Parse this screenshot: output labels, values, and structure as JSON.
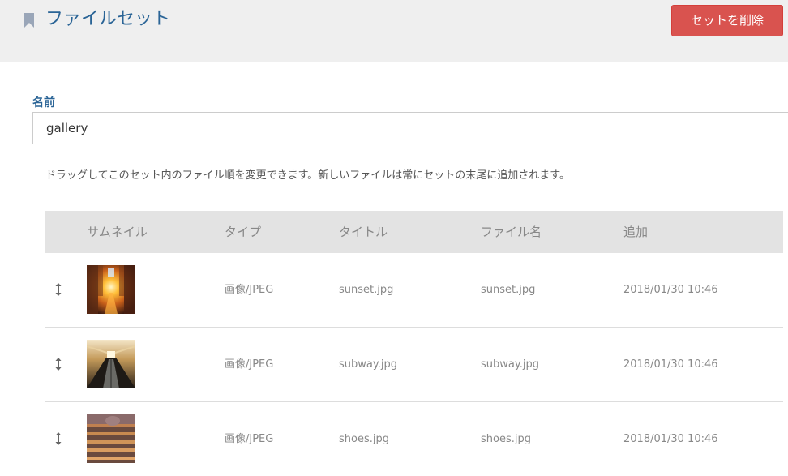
{
  "header": {
    "title": "ファイルセット",
    "delete_button": "セットを削除"
  },
  "form": {
    "name_label": "名前",
    "name_value": "gallery"
  },
  "help_text": "ドラッグしてこのセット内のファイル順を変更できます。新しいファイルは常にセットの末尾に追加されます。",
  "table": {
    "columns": [
      "サムネイル",
      "タイプ",
      "タイトル",
      "ファイル名",
      "追加"
    ],
    "rows": [
      {
        "type": "画像/JPEG",
        "title": "sunset.jpg",
        "filename": "sunset.jpg",
        "added": "2018/01/30 10:46",
        "thumb": "sunset"
      },
      {
        "type": "画像/JPEG",
        "title": "subway.jpg",
        "filename": "subway.jpg",
        "added": "2018/01/30 10:46",
        "thumb": "subway"
      },
      {
        "type": "画像/JPEG",
        "title": "shoes.jpg",
        "filename": "shoes.jpg",
        "added": "2018/01/30 10:46",
        "thumb": "shoes"
      }
    ]
  },
  "colors": {
    "title": "#2a6496",
    "danger": "#d9534f",
    "header_bg": "#efefef",
    "table_head_bg": "#e3e3e3"
  },
  "icons": {
    "title": "bookmark-icon",
    "row_handle": "drag-handle-icon"
  }
}
